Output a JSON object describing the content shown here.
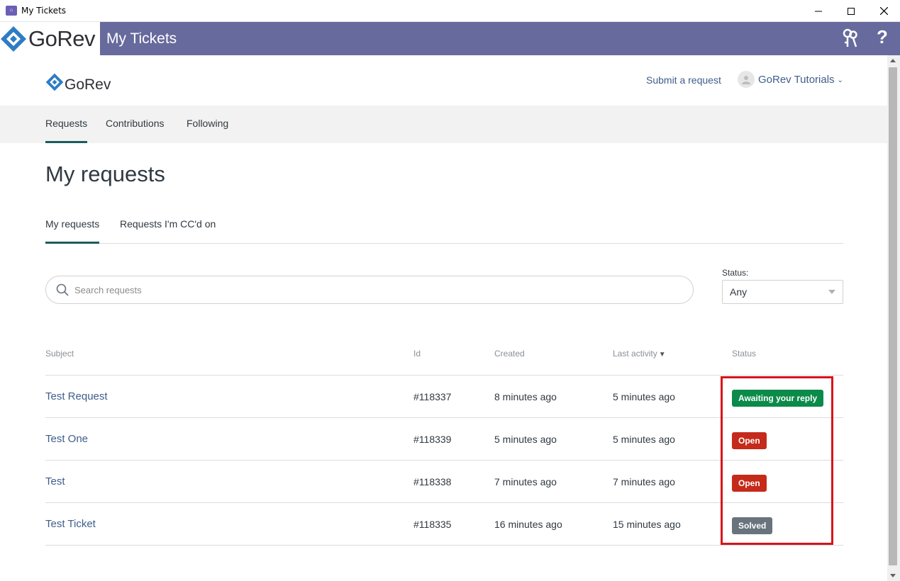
{
  "window": {
    "title": "My Tickets"
  },
  "appbar": {
    "brand": "GoRev",
    "title": "My Tickets",
    "help_label": "?",
    "color": "#676a9c"
  },
  "site_header": {
    "logo_text": "GoRev",
    "submit_link": "Submit a request",
    "user_name": "GoRev Tutorials",
    "user_chevron": "⌄"
  },
  "subnav": {
    "items": [
      {
        "label": "Requests",
        "active": true
      },
      {
        "label": "Contributions",
        "active": false
      },
      {
        "label": "Following",
        "active": false
      }
    ]
  },
  "main": {
    "title": "My requests",
    "tabs": [
      {
        "label": "My requests",
        "active": true
      },
      {
        "label": "Requests I'm CC'd on",
        "active": false
      }
    ],
    "search_placeholder": "Search requests",
    "status_filter": {
      "label": "Status:",
      "value": "Any"
    }
  },
  "table": {
    "headers": {
      "subject": "Subject",
      "id": "Id",
      "created": "Created",
      "last_activity": "Last activity",
      "sort_indicator": "▼",
      "status": "Status"
    },
    "rows": [
      {
        "subject": "Test Request",
        "id": "#118337",
        "created": "8 minutes ago",
        "last_activity": "5 minutes ago",
        "status": "Awaiting your reply",
        "status_color": "#0b8a4a"
      },
      {
        "subject": "Test One",
        "id": "#118339",
        "created": "5 minutes ago",
        "last_activity": "5 minutes ago",
        "status": "Open",
        "status_color": "#c52a1a"
      },
      {
        "subject": "Test",
        "id": "#118338",
        "created": "7 minutes ago",
        "last_activity": "7 minutes ago",
        "status": "Open",
        "status_color": "#c52a1a"
      },
      {
        "subject": "Test Ticket",
        "id": "#118335",
        "created": "16 minutes ago",
        "last_activity": "15 minutes ago",
        "status": "Solved",
        "status_color": "#68737d"
      }
    ]
  },
  "colors": {
    "accent": "#1e5c5c",
    "link": "#3f5d8a",
    "highlight": "#d7141a"
  }
}
